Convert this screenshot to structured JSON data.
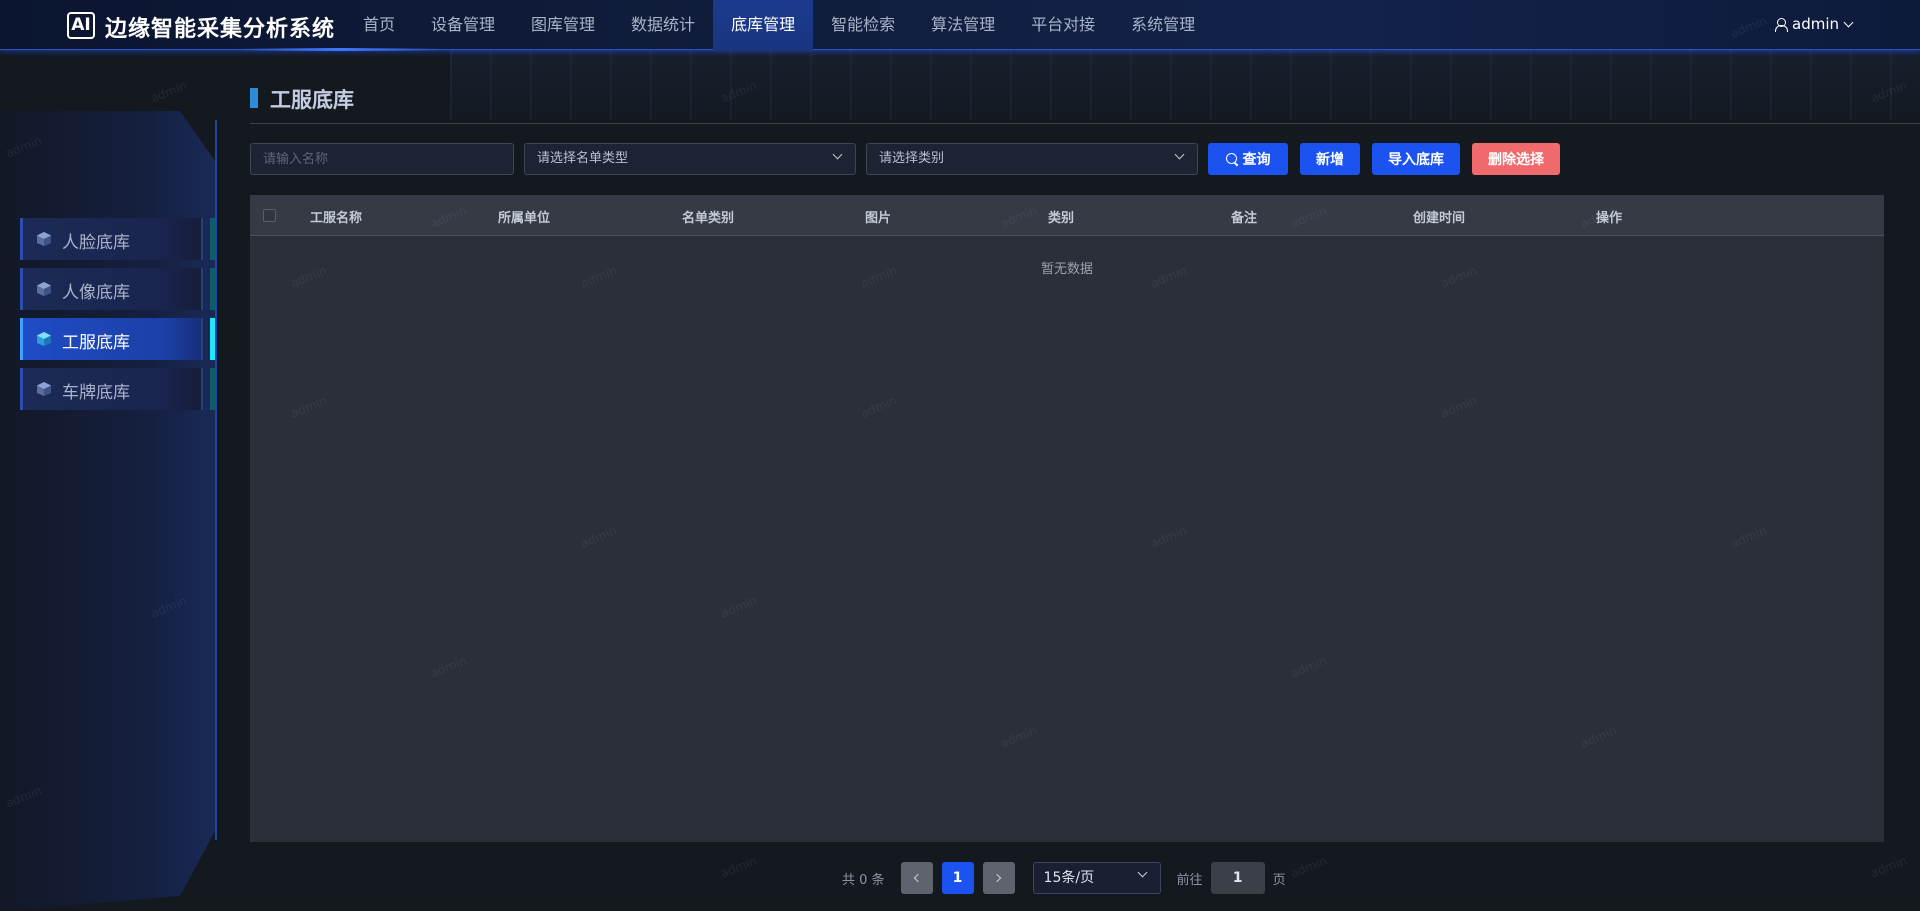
{
  "app": {
    "logo_text": "AI",
    "title": "边缘智能采集分析系统"
  },
  "nav": {
    "items": [
      {
        "label": "首页",
        "active": false
      },
      {
        "label": "设备管理",
        "active": false
      },
      {
        "label": "图库管理",
        "active": false
      },
      {
        "label": "数据统计",
        "active": false
      },
      {
        "label": "底库管理",
        "active": true
      },
      {
        "label": "智能检索",
        "active": false
      },
      {
        "label": "算法管理",
        "active": false
      },
      {
        "label": "平台对接",
        "active": false
      },
      {
        "label": "系统管理",
        "active": false
      }
    ]
  },
  "user": {
    "name": "admin"
  },
  "sidebar": {
    "items": [
      {
        "label": "人脸底库",
        "icon": "cube-icon",
        "active": false
      },
      {
        "label": "人像底库",
        "icon": "cube-icon",
        "active": false
      },
      {
        "label": "工服底库",
        "icon": "cube-icon",
        "active": true
      },
      {
        "label": "车牌底库",
        "icon": "cube-icon",
        "active": false
      }
    ]
  },
  "page": {
    "title": "工服底库"
  },
  "filters": {
    "name_placeholder": "请输入名称",
    "list_type_placeholder": "请选择名单类型",
    "category_placeholder": "请选择类别",
    "query_label": "查询",
    "add_label": "新增",
    "import_label": "导入底库",
    "delete_label": "删除选择"
  },
  "table": {
    "columns": [
      "工服名称",
      "所属单位",
      "名单类别",
      "图片",
      "类别",
      "备注",
      "创建时间",
      "操作"
    ],
    "rows": [],
    "empty_text": "暂无数据"
  },
  "pagination": {
    "total_text": "共 0 条",
    "current_page": "1",
    "page_size": "15条/页",
    "goto_label": "前往",
    "goto_value": "1",
    "page_suffix": "页"
  },
  "watermark": "admin",
  "colors": {
    "primary": "#1b52f0",
    "danger": "#f06a6d",
    "accent": "#25e6ff"
  }
}
